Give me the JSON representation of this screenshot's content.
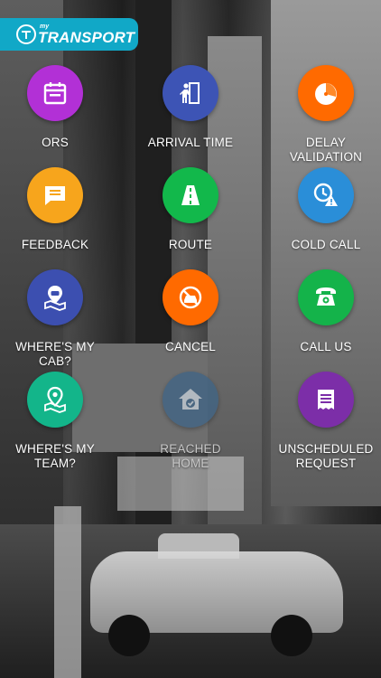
{
  "app": {
    "logo_small": "my",
    "logo_big": "TRANSPORT"
  },
  "tiles": [
    {
      "label": "ORS",
      "color": "#b230d6",
      "icon": "calendar-icon"
    },
    {
      "label": "ARRIVAL TIME",
      "color": "#3d54b5",
      "icon": "person-door-icon"
    },
    {
      "label": "DELAY\nVALIDATION",
      "color": "#ff6a00",
      "icon": "clock-pie-icon"
    },
    {
      "label": "FEEDBACK",
      "color": "#f7a51c",
      "icon": "message-icon"
    },
    {
      "label": "ROUTE",
      "color": "#12b84b",
      "icon": "road-icon"
    },
    {
      "label": "COLD CALL",
      "color": "#2a8ed8",
      "icon": "clock-warning-icon"
    },
    {
      "label": "WHERE'S MY\nCAB?",
      "color": "#3c4fb0",
      "icon": "cab-pin-icon"
    },
    {
      "label": "CANCEL",
      "color": "#ff6a00",
      "icon": "no-car-icon"
    },
    {
      "label": "CALL US",
      "color": "#14b34a",
      "icon": "telephone-icon"
    },
    {
      "label": "WHERE'S MY\nTEAM?",
      "color": "#13b58a",
      "icon": "map-pin-icon"
    },
    {
      "label": "REACHED\nHOME",
      "color": "#3e6486",
      "icon": "home-check-icon",
      "disabled": true
    },
    {
      "label": "UNSCHEDULED\nREQUEST",
      "color": "#7c2ea8",
      "icon": "document-icon"
    }
  ]
}
